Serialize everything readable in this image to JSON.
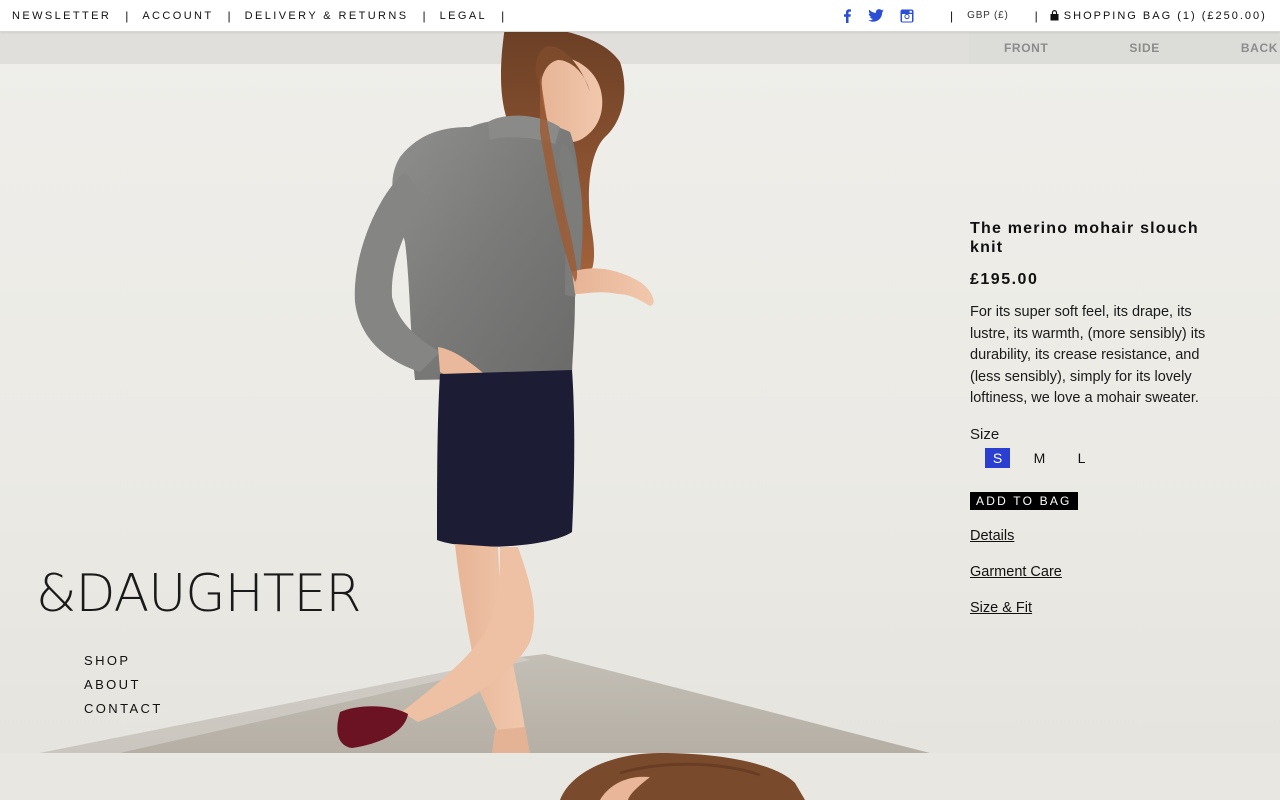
{
  "topbar": {
    "links": [
      "NEWSLETTER",
      "ACCOUNT",
      "DELIVERY & RETURNS",
      "LEGAL"
    ],
    "social": [
      "facebook-icon",
      "twitter-icon",
      "instagram-icon"
    ],
    "currency": "GBP (£)",
    "bag": "SHOPPING BAG (1) (£250.00)"
  },
  "view_tabs": [
    "FRONT",
    "SIDE",
    "BACK"
  ],
  "brand": {
    "logo": "&DAUGHTER"
  },
  "side_nav": [
    "SHOP",
    "ABOUT",
    "CONTACT"
  ],
  "product": {
    "title": "The merino mohair slouch knit",
    "price": "£195.00",
    "description": "For its super soft feel, its drape, its lustre, its warmth, (more sensibly) its durability, its crease resistance, and (less sensibly), simply for its lovely loftiness, we love a mohair sweater.",
    "size_label": "Size",
    "sizes": [
      "S",
      "M",
      "L"
    ],
    "selected_size": "S",
    "add_to_bag": "ADD TO BAG",
    "links": [
      "Details",
      "Garment Care",
      "Size & Fit"
    ]
  },
  "colors": {
    "accent": "#2a3fd0",
    "button": "#000000",
    "background": "#ecebe6"
  }
}
